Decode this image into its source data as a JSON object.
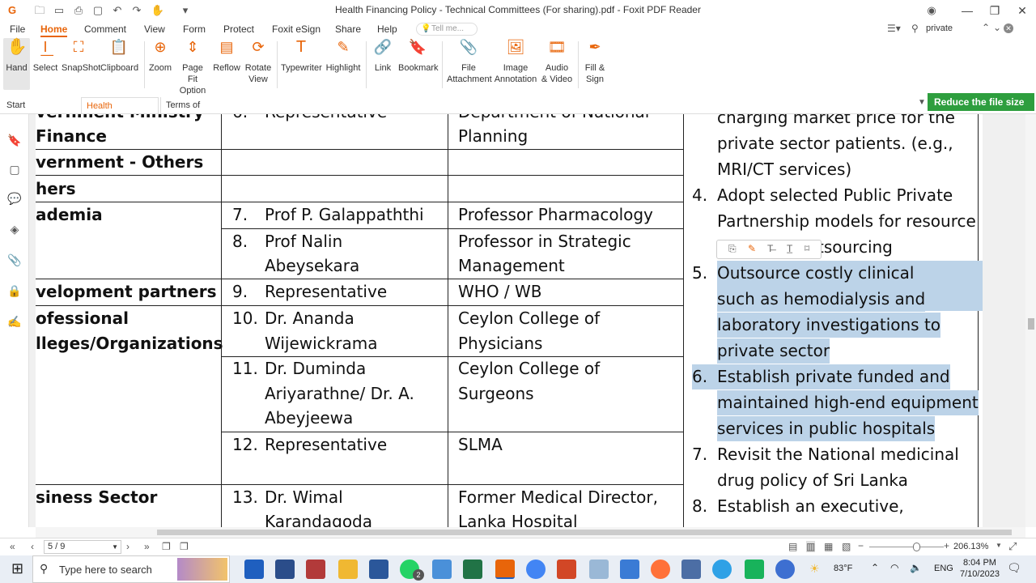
{
  "app": {
    "title": "Health Financing Policy - Technical Committees (For sharing).pdf - Foxit PDF Reader",
    "accent": "#e8650a"
  },
  "menu": [
    "File",
    "Home",
    "Comment",
    "View",
    "Form",
    "Protect",
    "Foxit eSign",
    "Share",
    "Help"
  ],
  "tell_me_placeholder": "Tell me...",
  "search_value": "private",
  "ribbon": {
    "hand": "Hand",
    "select": "Select",
    "snapshot": "SnapShot",
    "clipboard": "Clipboard",
    "zoom": "Zoom",
    "page_fit_1": "Page Fit",
    "page_fit_2": "Option",
    "reflow": "Reflow",
    "rotate_1": "Rotate",
    "rotate_2": "View",
    "typewriter": "Typewriter",
    "highlight": "Highlight",
    "link": "Link",
    "bookmark": "Bookmark",
    "file_att_1": "File",
    "file_att_2": "Attachment",
    "image_ann_1": "Image",
    "image_ann_2": "Annotation",
    "audio_1": "Audio",
    "audio_2": "& Video",
    "fill_1": "Fill &",
    "fill_2": "Sign"
  },
  "tabs": {
    "start": "Start",
    "doc": "Health Financin...",
    "terms": "Terms of Reference"
  },
  "reduce_label": "Reduce the file size",
  "table": {
    "r0_c1": "vernment  Ministry",
    "r0_c1b": "Finance",
    "r0_num": "6.",
    "r0_name": "Representative",
    "r0_org": "Department of National",
    "r0_org2": "Planning",
    "r1": "vernment - Others",
    "r2": "hers",
    "r3_cat": "ademia",
    "r3_num": "7.",
    "r3_name": "Prof P. Galappaththi",
    "r3_org": "Professor Pharmacology",
    "r4_num": "8.",
    "r4_name1": "Prof Nalin",
    "r4_name2": "Abeysekara",
    "r4_org1": "Professor in Strategic",
    "r4_org2": "Management",
    "r5_cat": "velopment partners",
    "r5_num": "9.",
    "r5_name": "Representative",
    "r5_org": "WHO / WB",
    "r6_cat1": "ofessional",
    "r6_cat2": "lleges/Organizations",
    "r6_num": "10.",
    "r6_name1": "Dr. Ananda",
    "r6_name2": "Wijewickrama",
    "r6_org1": "Ceylon College of",
    "r6_org2": "Physicians",
    "r7_num": "11.",
    "r7_name1": "Dr. Duminda",
    "r7_name2": "Ariyarathne/ Dr. A.",
    "r7_name3": "Abeyjeewa",
    "r7_org1": "Ceylon College of",
    "r7_org2": "Surgeons",
    "r8_num": "12.",
    "r8_name": "Representative",
    "r8_org": "SLMA",
    "r9_cat": "siness Sector",
    "r9_num": "13.",
    "r9_name1": "Dr. Wimal",
    "r9_name2": "Karandagoda",
    "r9_org1": "Former Medical Director,",
    "r9_org2": "Lanka Hospital"
  },
  "list": {
    "l0": "charging market price for the",
    "l1": "private sector patients. (e.g.,",
    "l2": "MRI/CT services)",
    "n4": "4.",
    "l4a": "Adopt selected Public Private",
    "l4b": "Partnership models for resource",
    "l4c": "tsourcing",
    "n5": "5.",
    "l5a": "Outsource costly clinical services",
    "l5b": "such as hemodialysis and",
    "l5c": "laboratory investigations to",
    "l5d": "private sector",
    "n6": "6.",
    "l6a": "Establish private funded and",
    "l6b": "maintained high-end equipment",
    "l6c": "services in public hospitals",
    "n7": "7.",
    "l7a": "Revisit the National medicinal",
    "l7b": "drug policy of Sri Lanka",
    "n8": "8.",
    "l8a": "Establish an executive,"
  },
  "status": {
    "page": "5 / 9",
    "zoom": "206.13%"
  },
  "taskbar": {
    "search": "Type here to search",
    "temp": "83°F",
    "lang": "ENG",
    "time": "8:04 PM",
    "date": "7/10/2023",
    "badge": "2"
  }
}
